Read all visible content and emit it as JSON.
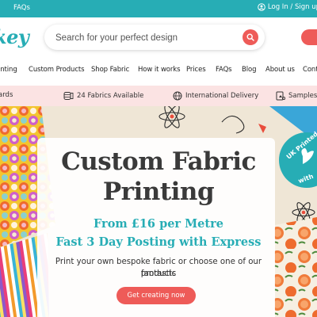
{
  "topbar": {
    "faqs": "FAQs",
    "login": "Log In / Sign up"
  },
  "header": {
    "logo_text": "key",
    "search_placeholder": "Search for your perfect design"
  },
  "nav": {
    "items": [
      "inting",
      "Custom Products",
      "Shop Fabric",
      "How it works",
      "Prices",
      "FAQs",
      "Blog",
      "About us",
      "Cont"
    ]
  },
  "features": {
    "items": [
      "ards",
      "24 Fabrics Available",
      "International Delivery",
      "Samples"
    ]
  },
  "hero": {
    "title_line1": "Custom Fabric",
    "title_line2": "Printing",
    "subtitle_line1": "From £16 per Metre",
    "subtitle_line2": "Fast 3 Day Posting with Express",
    "description_line1": "Print your own bespoke fabric or choose one of our fantastic",
    "description_line2": "products",
    "button": "Get creating now",
    "badge_top": "UK Printed",
    "badge_bottom": "with"
  },
  "colors": {
    "teal": "#27adb5",
    "coral": "#ee5b58",
    "pink_strip": "#fbe3e3"
  }
}
